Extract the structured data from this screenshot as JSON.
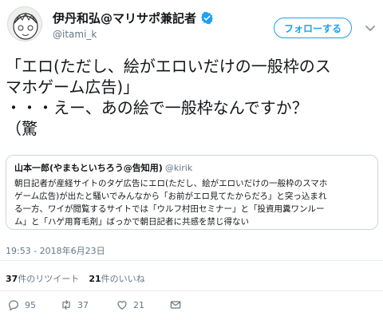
{
  "user": {
    "display_name": "伊丹和弘@マリサポ兼記者",
    "handle": "@itami_k",
    "follow_label": "フォローする"
  },
  "tweet": {
    "lines": [
      "「エロ(ただし、絵がエロいだけの一般枠のス",
      "マホゲーム広告)」",
      "・・・えー、あの絵で一般枠なんですか？",
      "（驚"
    ]
  },
  "quoted": {
    "name": "山本一郎(やまもといちろう@告知用)",
    "handle": "@kirik",
    "lines": [
      "朝日記者が産経サイトのタゲ広告にエロ(ただし、絵がエロいだけの一般枠のスマホ",
      "ゲーム広告)が出たと騒いでみんなから「お前がエロ見てたからだろ」と突っ込まれ",
      "る一方、ワイが閲覧するサイトでは「ウルフ村田セミナー」と「投資用糞ワンルー",
      "ム」と「ハゲ用育毛剤」ばっかで朝日記者に共感を禁じ得ない"
    ]
  },
  "timestamp": "19:53 - 2018年6月23日",
  "stats": {
    "retweets_count": "37",
    "retweets_label": "件のリツイート",
    "likes_count": "21",
    "likes_label": "件のいいね"
  },
  "actions": {
    "reply_count": "95",
    "retweet_count": "37",
    "like_count": "21"
  },
  "colors": {
    "accent": "#1da1f2",
    "text": "#14171a",
    "muted": "#657786",
    "border": "#e6ecf0"
  }
}
